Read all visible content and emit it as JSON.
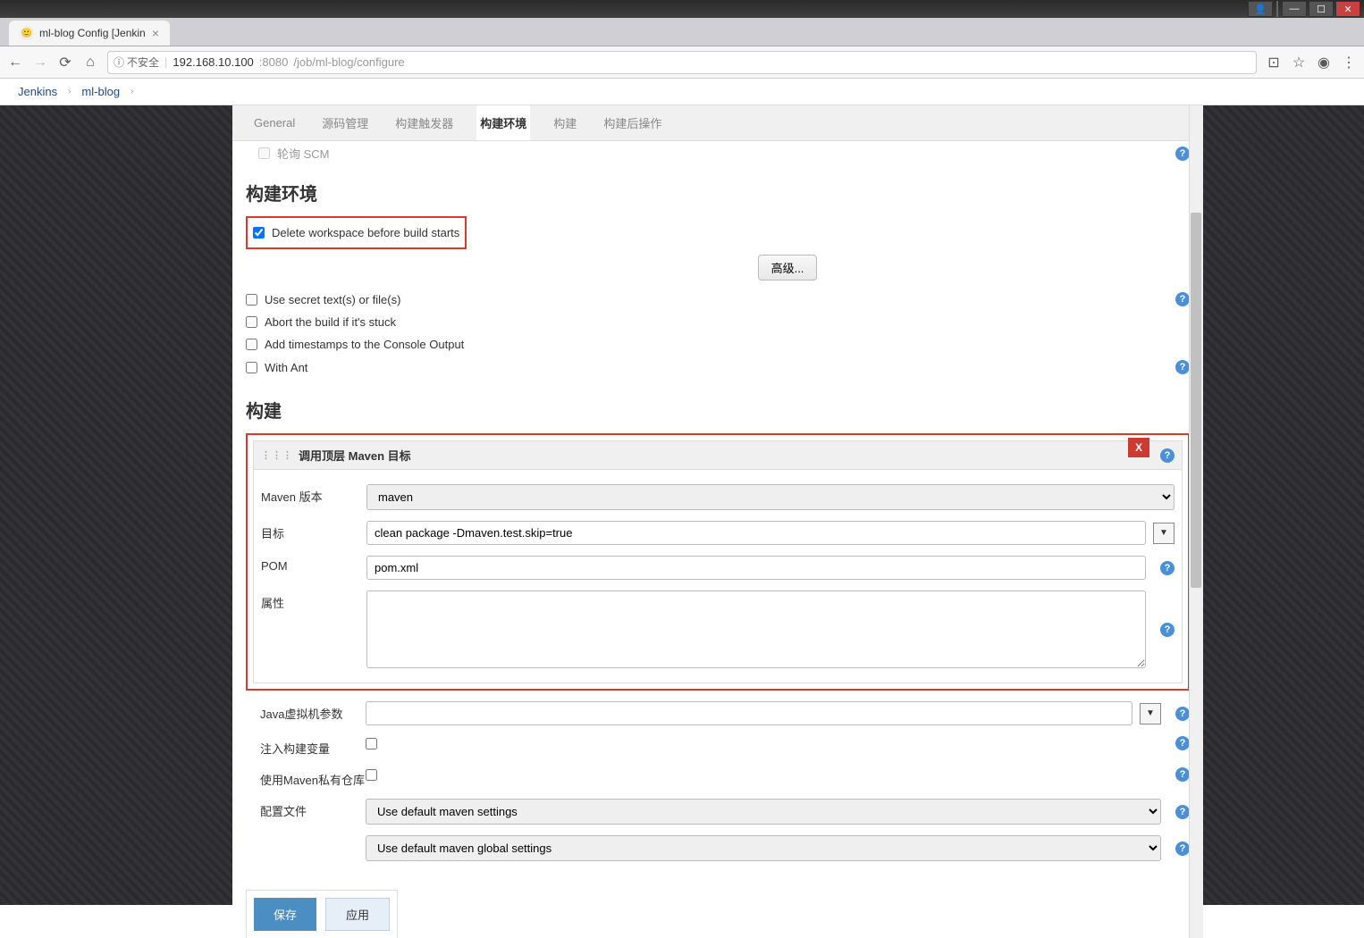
{
  "window": {
    "tab_title": "ml-blog Config [Jenkin"
  },
  "address": {
    "insecure_label": "不安全",
    "host": "192.168.10.100",
    "port": ":8080",
    "path": "/job/ml-blog/configure"
  },
  "breadcrumb": {
    "items": [
      "Jenkins",
      "ml-blog"
    ]
  },
  "config_tabs": {
    "general": "General",
    "scm": "源码管理",
    "triggers": "构建触发器",
    "env": "构建环境",
    "build": "构建",
    "post": "构建后操作"
  },
  "scm_partial": {
    "poll_scm": "轮询 SCM"
  },
  "env_section": {
    "title": "构建环境",
    "delete_ws": "Delete workspace before build starts",
    "advanced_btn": "高级...",
    "secret": "Use secret text(s) or file(s)",
    "abort": "Abort the build if it's stuck",
    "timestamps": "Add timestamps to the Console Output",
    "with_ant": "With Ant"
  },
  "build_section": {
    "title": "构建",
    "step_title": "调用顶层 Maven 目标",
    "delete_x": "X",
    "maven_version_label": "Maven 版本",
    "maven_version_value": "maven",
    "goals_label": "目标",
    "goals_value": "clean package -Dmaven.test.skip=true",
    "pom_label": "POM",
    "pom_value": "pom.xml",
    "props_label": "属性",
    "props_value": "",
    "jvm_label": "Java虚拟机参数",
    "jvm_value": "",
    "inject_label": "注入构建变量",
    "private_repo_label": "使用Maven私有仓库",
    "settings_label": "配置文件",
    "settings_value": "Use default maven settings",
    "global_settings_value": "Use default maven global settings"
  },
  "footer": {
    "save": "保存",
    "apply": "应用"
  }
}
